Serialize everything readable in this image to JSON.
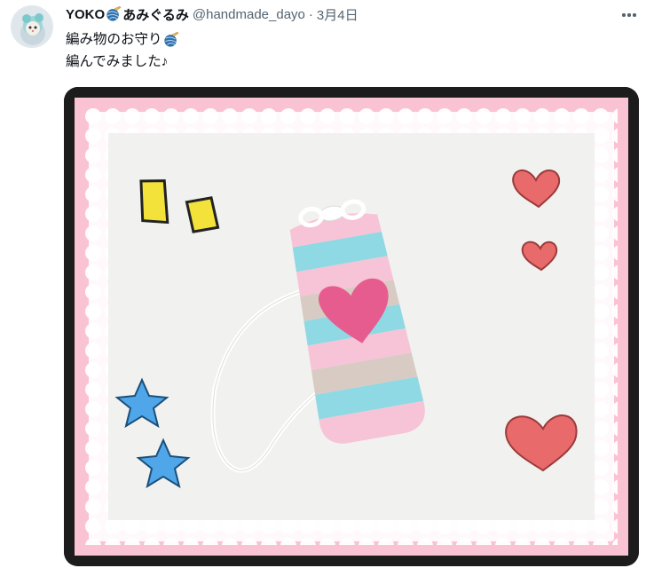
{
  "tweet": {
    "display_name": "YOKO",
    "name_suffix": "あみぐるみ",
    "handle": "@handmade_dayo",
    "separator": "·",
    "date": "3月4日",
    "text_line1": "編み物のお守り",
    "text_line2": "編んでみました♪"
  },
  "icons": {
    "yarn": "yarn-ball-icon",
    "more": "more-options-icon"
  },
  "colors": {
    "frame_pink": "#f9c3d3",
    "yarn_blue": "#2f6fa8",
    "heart_red": "#e86a6a",
    "star_blue": "#4fa6e8",
    "sparkle_yellow": "#f3e23a"
  }
}
